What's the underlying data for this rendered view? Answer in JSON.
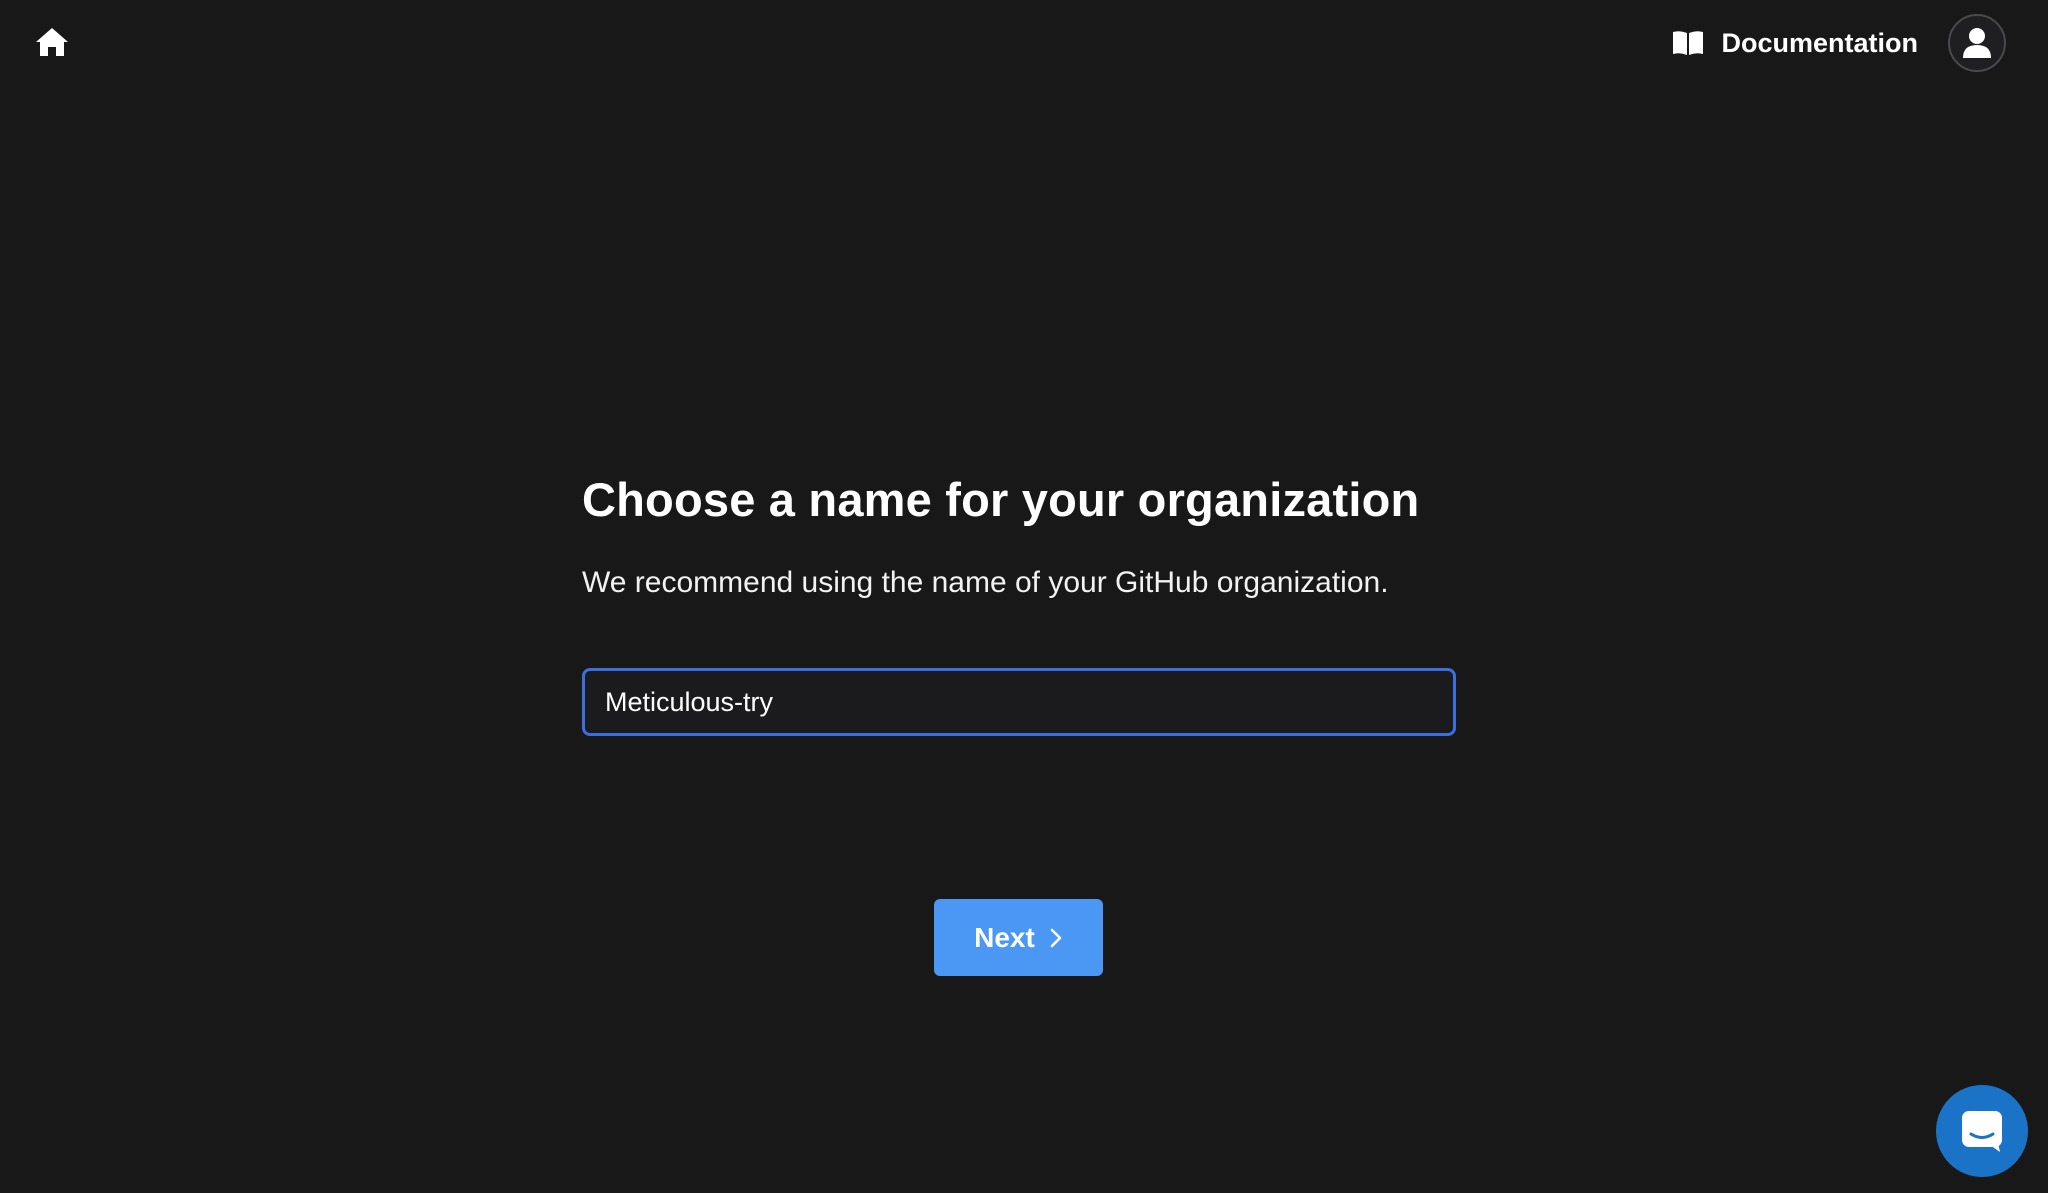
{
  "header": {
    "home_icon": "home-icon",
    "documentation_label": "Documentation",
    "documentation_icon": "book-open-icon",
    "avatar_icon": "user-icon"
  },
  "main": {
    "title": "Choose a name for your organization",
    "subtitle": "We recommend using the name of your GitHub organization.",
    "org_name_value": "Meticulous-try",
    "next_label": "Next",
    "next_icon": "chevron-right-icon"
  },
  "chat": {
    "icon": "chat-bubble-icon"
  },
  "colors": {
    "background": "#181819",
    "accent": "#4b97f4",
    "input_border": "#3b6fe0",
    "chat_button": "#1b73c8"
  }
}
